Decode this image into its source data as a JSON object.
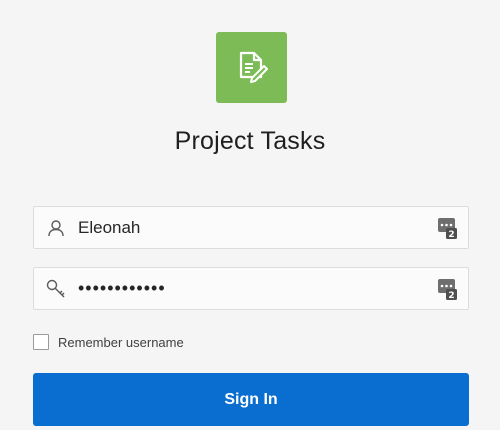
{
  "app": {
    "title": "Project Tasks",
    "logo_icon": "document-edit-icon",
    "accent_color": "#7dbb57"
  },
  "login": {
    "username": {
      "value": "Eleonah",
      "icon": "user-icon"
    },
    "password": {
      "value": "••••••••••••",
      "icon": "key-icon"
    },
    "remember_label": "Remember username",
    "remember_checked": false,
    "signin_label": "Sign In",
    "signin_color": "#0a6ed1"
  }
}
